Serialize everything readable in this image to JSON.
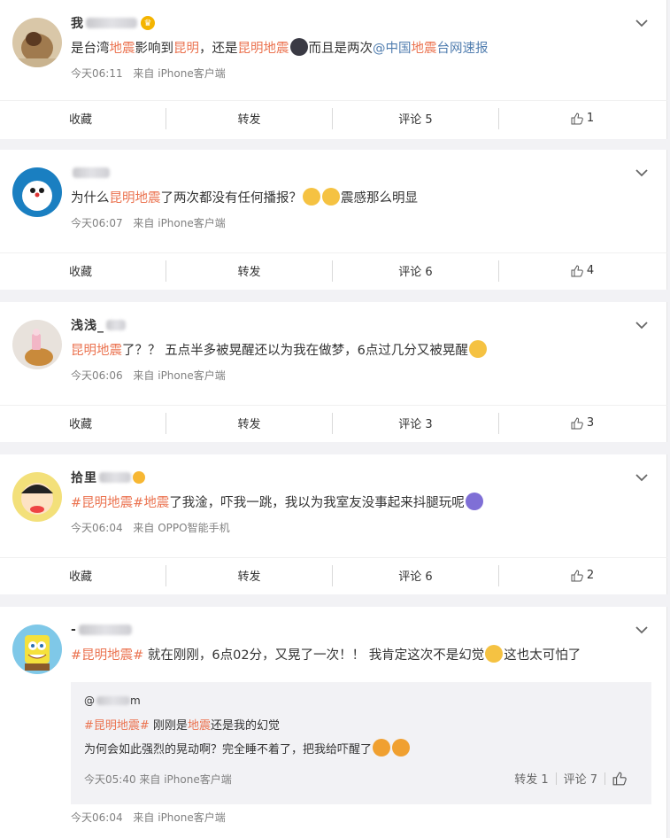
{
  "posts": [
    {
      "username_visible": "我",
      "text": [
        {
          "t": "是台湾"
        },
        {
          "t": "地震",
          "c": "red"
        },
        {
          "t": "影响到"
        },
        {
          "t": "昆明",
          "c": "red"
        },
        {
          "t": "，还是"
        },
        {
          "t": "昆明地震",
          "c": "red"
        },
        {
          "emoji": "face"
        },
        {
          "t": "而且是两次"
        },
        {
          "t": "@中国",
          "c": "blue"
        },
        {
          "t": "地震",
          "c": "red"
        },
        {
          "t": "台网速报",
          "c": "blue"
        }
      ],
      "time": "今天06:11",
      "source": "来自 iPhone客户端",
      "actions": {
        "fav": "收藏",
        "repost": "转发",
        "comment": "评论 5",
        "like": "1"
      }
    },
    {
      "username_visible": "",
      "text": [
        {
          "t": "为什么"
        },
        {
          "t": "昆明地震",
          "c": "red"
        },
        {
          "t": "了两次都没有任何播报？"
        },
        {
          "emoji": "sleep"
        },
        {
          "emoji": "sleep"
        },
        {
          "t": "震感那么明显"
        }
      ],
      "time": "今天06:07",
      "source": "来自 iPhone客户端",
      "actions": {
        "fav": "收藏",
        "repost": "转发",
        "comment": "评论 6",
        "like": "4"
      }
    },
    {
      "username_visible": "浅浅_",
      "text": [
        {
          "t": "昆明地震",
          "c": "red"
        },
        {
          "t": "了？？ 五点半多被晃醒还以为我在做梦，6点过几分又被晃醒"
        },
        {
          "emoji": "laugh"
        }
      ],
      "time": "今天06:06",
      "source": "来自 iPhone客户端",
      "actions": {
        "fav": "收藏",
        "repost": "转发",
        "comment": "评论 3",
        "like": "3"
      }
    },
    {
      "username_visible": "拾里",
      "text": [
        {
          "t": "#昆明地震#",
          "c": "red"
        },
        {
          "t": "地震",
          "c": "red"
        },
        {
          "t": "了我淦，吓我一跳，我以为我室友没事起来抖腿玩呢"
        },
        {
          "emoji": "scared"
        }
      ],
      "time": "今天06:04",
      "source": "来自 OPPO智能手机",
      "actions": {
        "fav": "收藏",
        "repost": "转发",
        "comment": "评论 6",
        "like": "2"
      }
    },
    {
      "username_visible": "-",
      "text": [
        {
          "t": "#昆明地震#",
          "c": "red"
        },
        {
          "t": " 就在刚刚，6点02分，又晃了一次！！ 我肯定这次不是幻觉"
        },
        {
          "emoji": "cry"
        },
        {
          "t": "这也太可怕了"
        }
      ],
      "repost": {
        "name_visible": "@",
        "name_tail": "m",
        "line1": [
          {
            "t": "#昆明地震#",
            "c": "red"
          },
          {
            "t": " 刚刚是"
          },
          {
            "t": "地震",
            "c": "red"
          },
          {
            "t": "还是我的幻觉"
          }
        ],
        "line2": "为何会如此强烈的晃动啊？完全睡不着了，把我给吓醒了",
        "time": "今天05:40 来自 iPhone客户端",
        "repost_label": "转发 1",
        "comment_label": "评论 7"
      },
      "time": "今天06:04",
      "source": "来自 iPhone客户端"
    }
  ],
  "colors": {
    "link_red": "#eb7350",
    "link_blue": "#507daf",
    "meta": "#808080",
    "bg": "#f2f2f5"
  }
}
